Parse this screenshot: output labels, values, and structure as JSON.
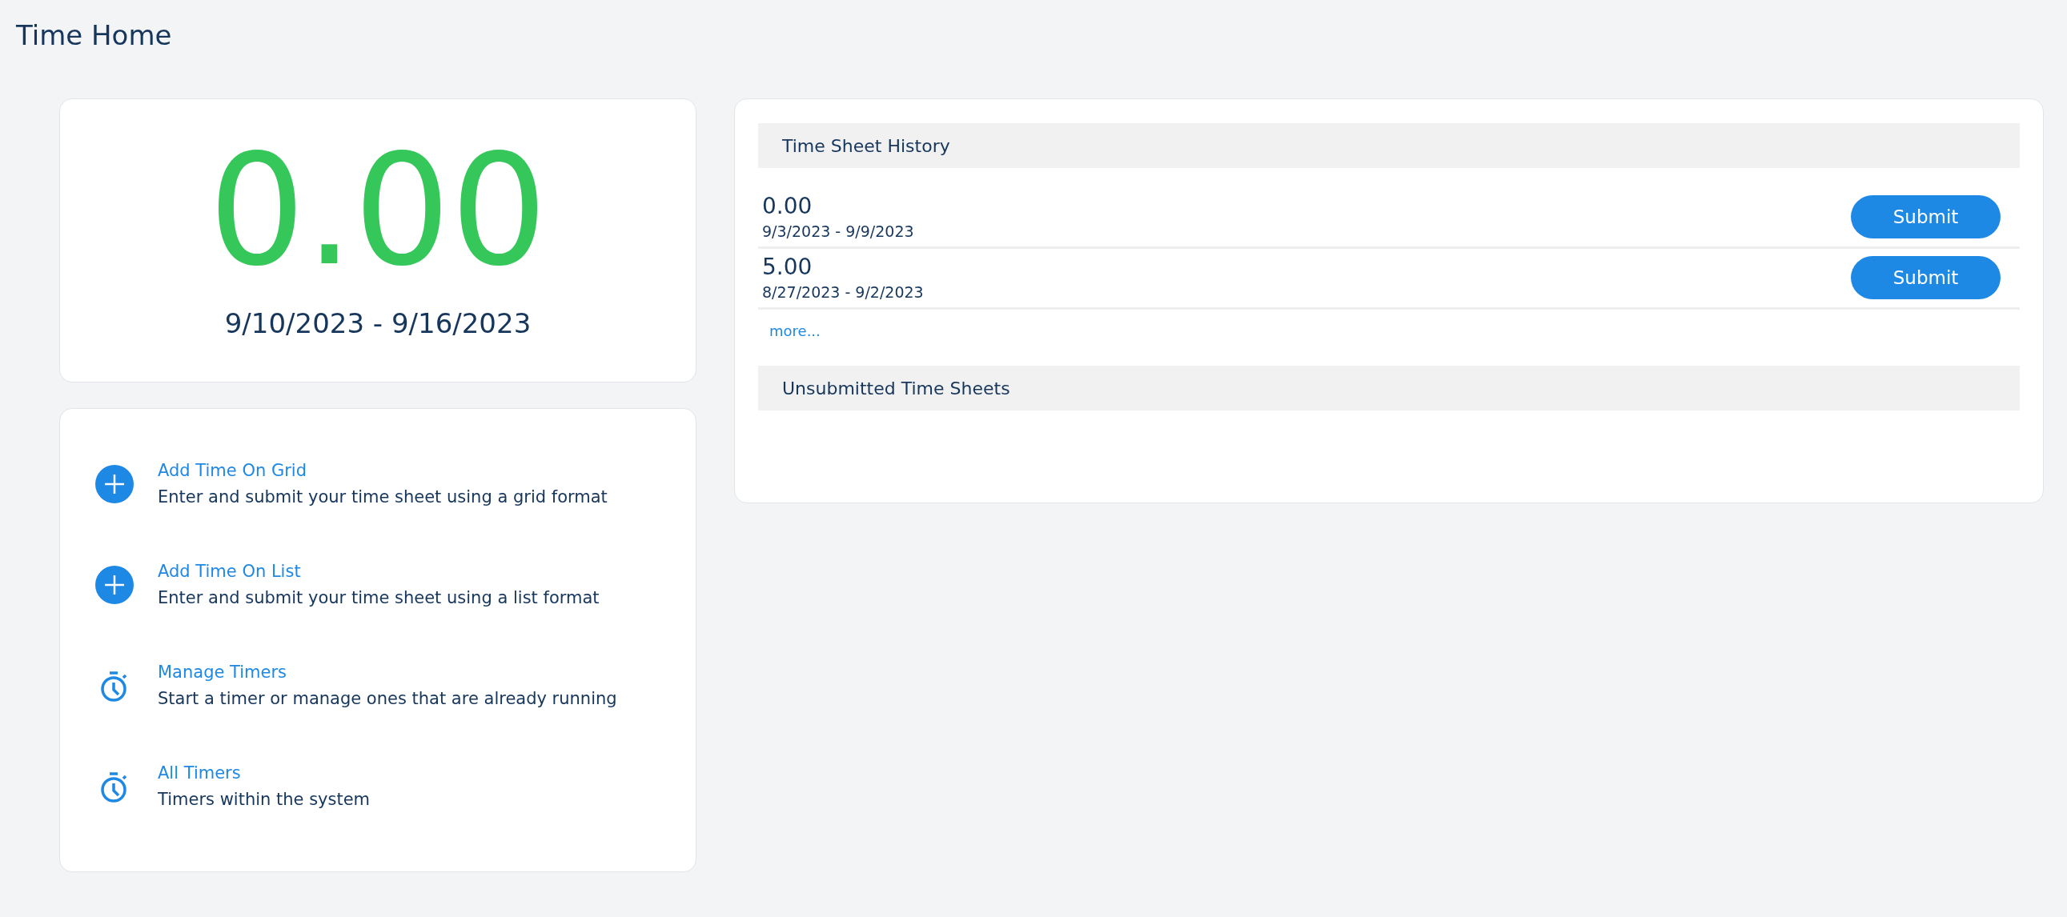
{
  "page_title": "Time Home",
  "current": {
    "hours": "0.00",
    "period": "9/10/2023 - 9/16/2023"
  },
  "actions": [
    {
      "kind": "add",
      "title": "Add Time On Grid",
      "description": "Enter and submit your time sheet using a grid format"
    },
    {
      "kind": "add",
      "title": "Add Time On List",
      "description": "Enter and submit your time sheet using a list format"
    },
    {
      "kind": "timer",
      "title": "Manage Timers",
      "description": "Start a timer or manage ones that are already running"
    },
    {
      "kind": "timer",
      "title": "All Timers",
      "description": "Timers within the system"
    }
  ],
  "history": {
    "title": "Time Sheet History",
    "rows": [
      {
        "hours": "0.00",
        "period": "9/3/2023 - 9/9/2023",
        "button": "Submit"
      },
      {
        "hours": "5.00",
        "period": "8/27/2023 - 9/2/2023",
        "button": "Submit"
      }
    ],
    "more": "more..."
  },
  "unsubmitted": {
    "title": "Unsubmitted Time Sheets"
  }
}
